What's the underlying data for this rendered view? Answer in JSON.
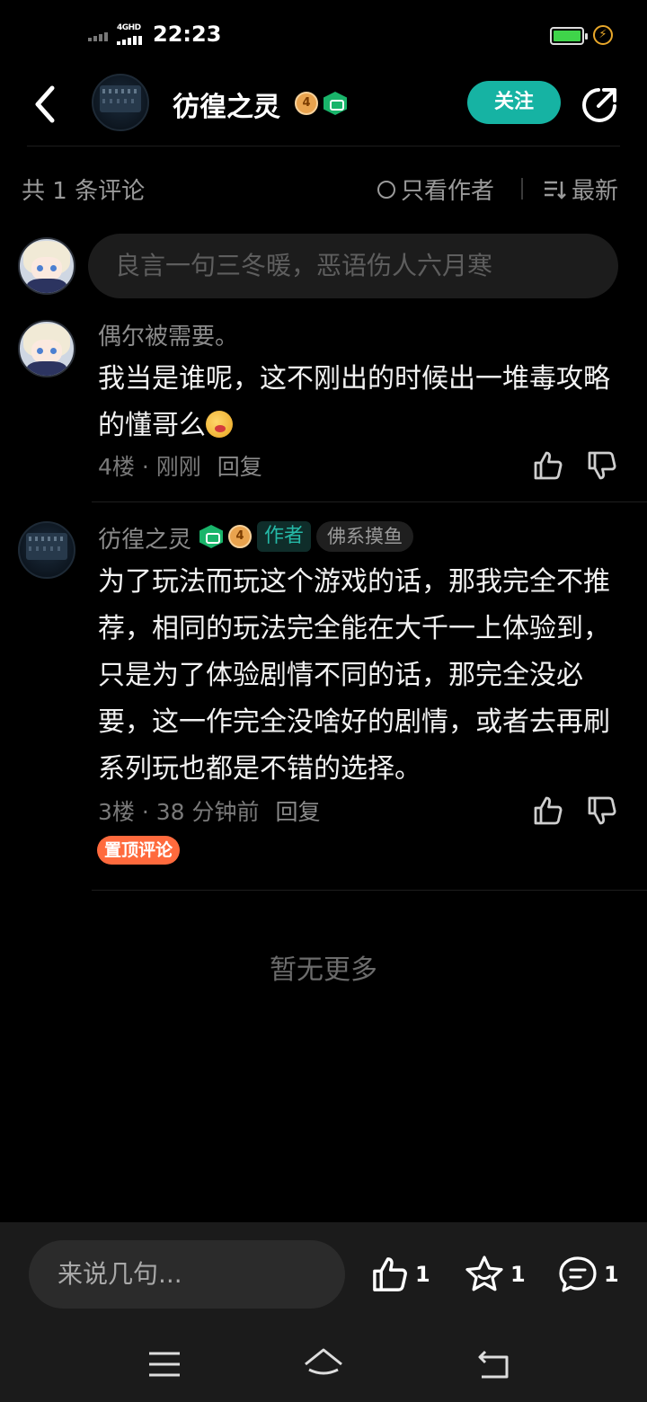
{
  "status_bar": {
    "network_label": "4GHD",
    "time": "22:23"
  },
  "header": {
    "username": "彷徨之灵",
    "level_badge": "4",
    "follow_label": "关注"
  },
  "filter_bar": {
    "count_text": "共 1 条评论",
    "author_only_label": "只看作者",
    "sort_label": "最新"
  },
  "comment_input": {
    "placeholder": "良言一句三冬暖，恶语伤人六月寒"
  },
  "comments": [
    {
      "username": "偶尔被需要。",
      "text": "我当是谁呢，这不刚出的时候出一堆毒攻略的懂哥么",
      "floor": "4楼",
      "time": "刚刚",
      "reply_label": "回复"
    },
    {
      "username": "彷徨之灵",
      "level_badge": "4",
      "author_tag": "作者",
      "title_tag": "佛系摸鱼",
      "text": "为了玩法而玩这个游戏的话，那我完全不推荐，相同的玩法完全能在大千一上体验到，只是为了体验剧情不同的话，那完全没必要，这一作完全没啥好的剧情，或者去再刷系列玩也都是不错的选择。",
      "floor": "3楼",
      "time": "38 分钟前",
      "reply_label": "回复",
      "pinned_label": "置顶评论"
    }
  ],
  "no_more_text": "暂无更多",
  "bottom_bar": {
    "input_placeholder": "来说几句...",
    "like_count": "1",
    "favorite_count": "1",
    "comment_count": "1"
  },
  "colors": {
    "accent": "#16b3a3",
    "pinned": "#ff6a3d",
    "background": "#000000"
  },
  "icons": [
    "back-icon",
    "share-icon",
    "thumb-up-icon",
    "thumb-down-icon",
    "star-icon",
    "comment-icon",
    "menu-icon",
    "home-icon",
    "return-icon"
  ]
}
